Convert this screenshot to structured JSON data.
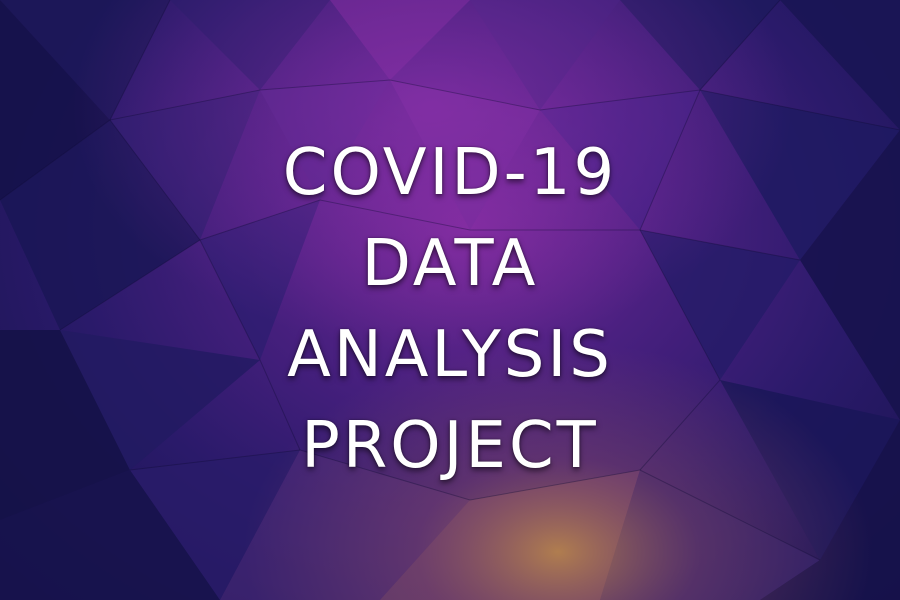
{
  "title_lines": [
    "COVID-19",
    "DATA",
    "ANALYSIS",
    "PROJECT"
  ],
  "colors": {
    "background_dark": "#16124a",
    "background_mid": "#2a1a6a",
    "highlight_purple": "#7a2a9a",
    "highlight_amber": "#b07a40",
    "text": "#ffffff"
  }
}
